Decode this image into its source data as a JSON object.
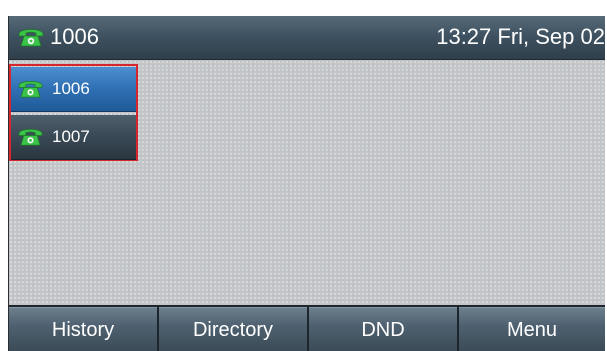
{
  "title_bar": {
    "account": "1006",
    "datetime": "13:27 Fri, Sep 02",
    "icon": "phone-icon"
  },
  "line_keys": [
    {
      "label": "1006",
      "icon": "phone-icon",
      "selected": true
    },
    {
      "label": "1007",
      "icon": "phone-icon",
      "selected": false
    }
  ],
  "softkeys": [
    {
      "label": "History"
    },
    {
      "label": "Directory"
    },
    {
      "label": "DND"
    },
    {
      "label": "Menu"
    }
  ],
  "colors": {
    "phone_icon": "#3cc34a",
    "selected_key": "#2f6fb3",
    "highlight_border": "#d8262e"
  }
}
